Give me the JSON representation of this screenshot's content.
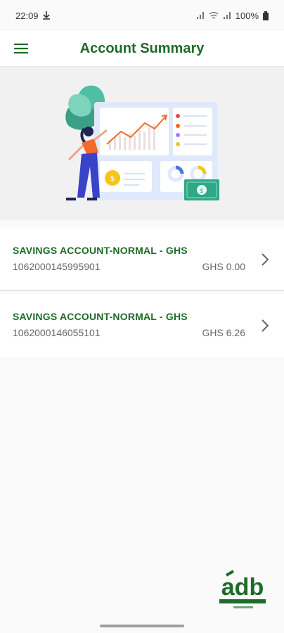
{
  "status_bar": {
    "time": "22:09",
    "battery": "100%"
  },
  "header": {
    "title": "Account Summary"
  },
  "accounts": [
    {
      "title": "SAVINGS ACCOUNT-NORMAL - GHS",
      "number": "1062000145995901",
      "balance": "GHS 0.00"
    },
    {
      "title": "SAVINGS ACCOUNT-NORMAL - GHS",
      "number": "1062000146055101",
      "balance": "GHS 6.26"
    }
  ],
  "icons": [
    "hamburger-icon",
    "chevron-right-icon",
    "download-icon",
    "wifi-icon",
    "signal-icon",
    "battery-icon"
  ],
  "colors": {
    "brand_green": "#1e6b2a",
    "accent_orange": "#f26b2a",
    "accent_yellow": "#f5c518"
  }
}
